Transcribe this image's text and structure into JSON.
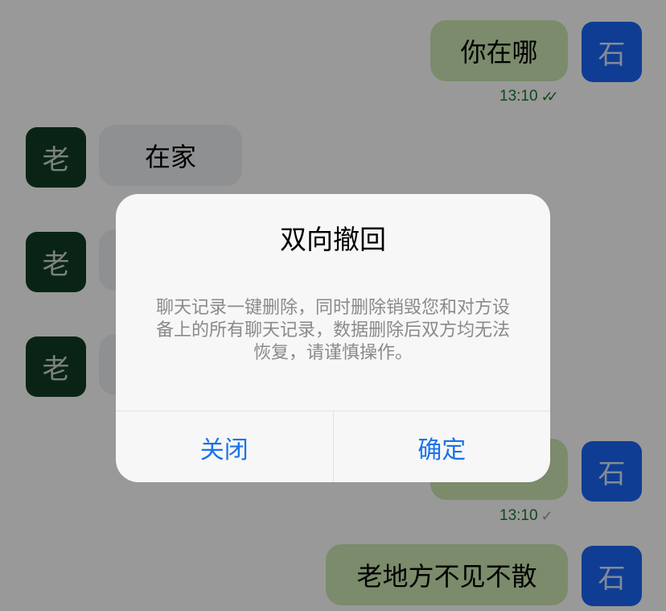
{
  "chat": {
    "self_avatar_text": "石",
    "peer_avatar_text": "老",
    "messages": [
      {
        "text": "你在哪",
        "time": "13:10",
        "ticks": "✓✓"
      },
      {
        "text": "在家"
      },
      {
        "text": ""
      },
      {
        "text": ""
      },
      {
        "text": "",
        "time": "13:10",
        "ticks": "✓"
      },
      {
        "text": "老地方不见不散"
      }
    ]
  },
  "dialog": {
    "title": "双向撤回",
    "message": "聊天记录一键删除，同时删除销毁您和对方设备上的所有聊天记录，数据删除后双方均无法恢复，请谨慎操作。",
    "cancel_label": "关闭",
    "confirm_label": "确定"
  },
  "colors": {
    "self_avatar": "#1a66f5",
    "peer_avatar": "#0f3d23",
    "outgoing_bubble": "#cde8b3",
    "incoming_bubble": "#eef0f3",
    "dialog_button": "#1a73e8",
    "read_ticks": "#1c7a2b"
  }
}
